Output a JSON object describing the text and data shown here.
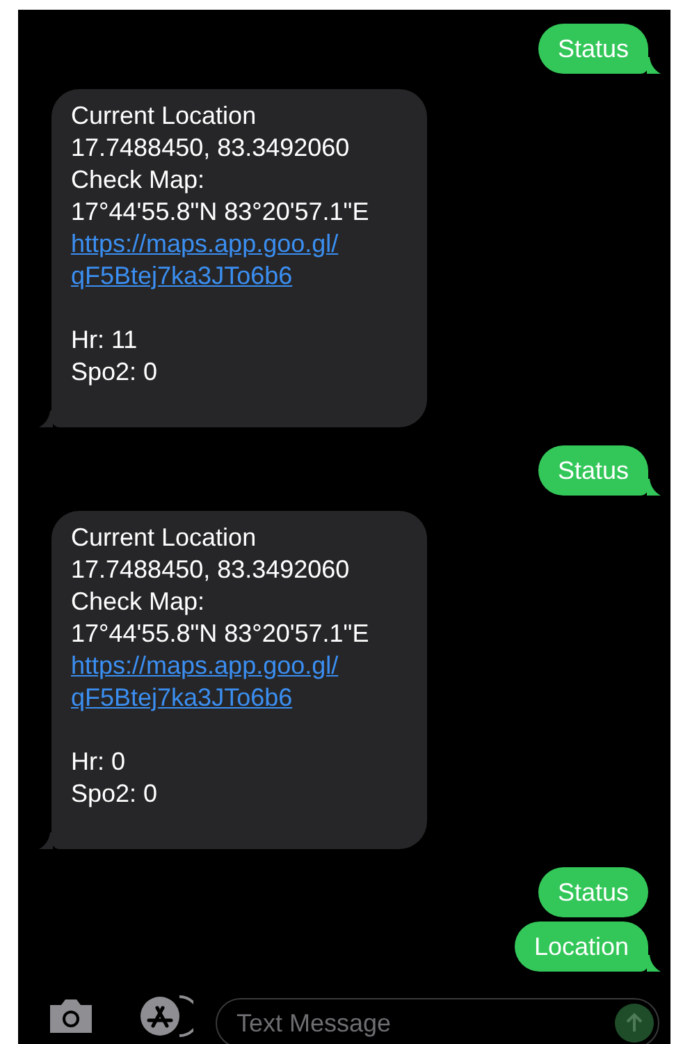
{
  "messages": [
    {
      "kind": "sent",
      "text": "Status"
    },
    {
      "kind": "received",
      "paragraphs": [
        [
          {
            "kind": "text",
            "text": "Current Location"
          },
          {
            "kind": "text",
            "text": "17.7488450, 83.3492060"
          },
          {
            "kind": "text",
            "text": "Check Map:"
          },
          {
            "kind": "text",
            "text": "17°44'55.8\"N 83°20'57.1\"E"
          },
          {
            "kind": "link",
            "text": "https://maps.app.goo.gl/"
          },
          {
            "kind": "link",
            "text": "qF5Btej7ka3JTo6b6"
          }
        ],
        [
          {
            "kind": "text",
            "text": "Hr: 11"
          },
          {
            "kind": "text",
            "text": "Spo2: 0"
          }
        ]
      ]
    },
    {
      "kind": "sent",
      "text": "Status"
    },
    {
      "kind": "received",
      "paragraphs": [
        [
          {
            "kind": "text",
            "text": "Current Location"
          },
          {
            "kind": "text",
            "text": "17.7488450, 83.3492060"
          },
          {
            "kind": "text",
            "text": "Check Map:"
          },
          {
            "kind": "text",
            "text": "17°44'55.8\"N 83°20'57.1\"E"
          },
          {
            "kind": "link",
            "text": "https://maps.app.goo.gl/"
          },
          {
            "kind": "link",
            "text": "qF5Btej7ka3JTo6b6"
          }
        ],
        [
          {
            "kind": "text",
            "text": "Hr: 0"
          },
          {
            "kind": "text",
            "text": "Spo2: 0"
          }
        ]
      ]
    },
    {
      "kind": "sent",
      "text": "Status",
      "tail": false
    },
    {
      "kind": "sent",
      "text": "Location",
      "tail": true
    }
  ],
  "composer": {
    "placeholder": "Text Message"
  }
}
